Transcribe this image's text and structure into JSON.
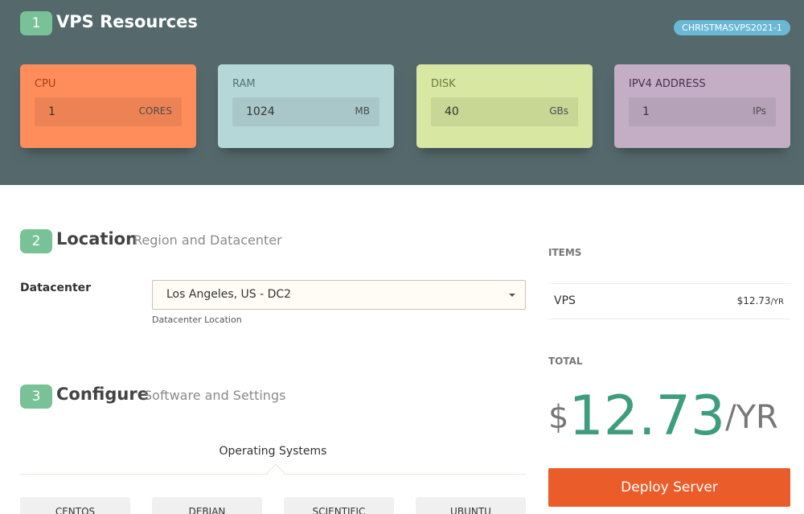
{
  "resources": {
    "step": "1",
    "title": "VPS Resources",
    "promo_code": "CHRISTMASVPS2021-1",
    "cards": [
      {
        "label": "CPU",
        "value": "1",
        "unit": "CORES",
        "color": "#ff8d5c",
        "label_color": "#a33f14"
      },
      {
        "label": "RAM",
        "value": "1024",
        "unit": "MB",
        "color": "#b6d7d8",
        "label_color": "#4f7779"
      },
      {
        "label": "DISK",
        "value": "40",
        "unit": "GBs",
        "color": "#d8e7a2",
        "label_color": "#6d7d31"
      },
      {
        "label": "IPV4 ADDRESS",
        "value": "1",
        "unit": "IPs",
        "color": "#c3aec6",
        "label_color": "#4c2f4f"
      }
    ]
  },
  "location": {
    "step": "2",
    "title": "Location",
    "subtitle": "Region and Datacenter",
    "datacenter_label": "Datacenter",
    "datacenter_value": "Los Angeles, US - DC2",
    "datacenter_help": "Datacenter Location"
  },
  "configure": {
    "step": "3",
    "title": "Configure",
    "subtitle": "Software and Settings",
    "os_heading": "Operating Systems",
    "os_options": [
      "CENTOS",
      "DEBIAN",
      "SCIENTIFIC",
      "UBUNTU"
    ]
  },
  "summary": {
    "items_label": "ITEMS",
    "items": [
      {
        "name": "VPS",
        "price": "$12.73",
        "period": "/YR"
      }
    ],
    "total_label": "TOTAL",
    "total_currency": "$",
    "total_amount": "12.73",
    "total_period": "/YR",
    "deploy_label": "Deploy Server"
  },
  "colors": {
    "header_bg": "#55696c",
    "step_badge": "#79c196",
    "promo_badge": "#6ab8d5",
    "total_green": "#3d9d7d",
    "deploy_orange": "#ea5d2a"
  }
}
